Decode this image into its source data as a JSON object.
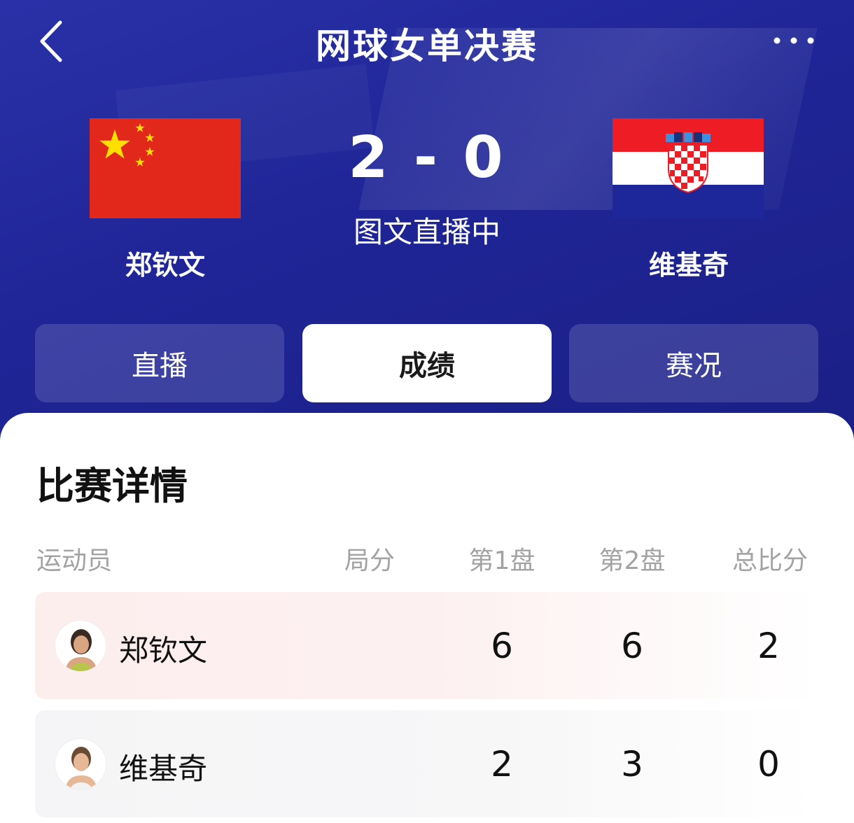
{
  "header": {
    "title": "网球女单决赛"
  },
  "match": {
    "score": "2 - 0",
    "status": "图文直播中",
    "player_left": {
      "name": "郑钦文",
      "flag": "china-flag"
    },
    "player_right": {
      "name": "维基奇",
      "flag": "croatia-flag"
    }
  },
  "tabs": [
    {
      "label": "直播",
      "active": false
    },
    {
      "label": "成绩",
      "active": true
    },
    {
      "label": "赛况",
      "active": false
    }
  ],
  "details": {
    "title": "比赛详情",
    "columns": [
      "运动员",
      "局分",
      "第1盘",
      "第2盘",
      "总比分"
    ],
    "rows": [
      {
        "name": "郑钦文",
        "games": "",
        "set1": "6",
        "set2": "6",
        "total": "2"
      },
      {
        "name": "维基奇",
        "games": "",
        "set1": "2",
        "set2": "3",
        "total": "0"
      }
    ]
  },
  "colors": {
    "hero_bg": "#1f2596",
    "china_red": "#e2271b",
    "star_yellow": "#ffde00",
    "croatia_red": "#ee1c25",
    "croatia_blue": "#1e2799",
    "row_highlight": "#fdeeee"
  }
}
